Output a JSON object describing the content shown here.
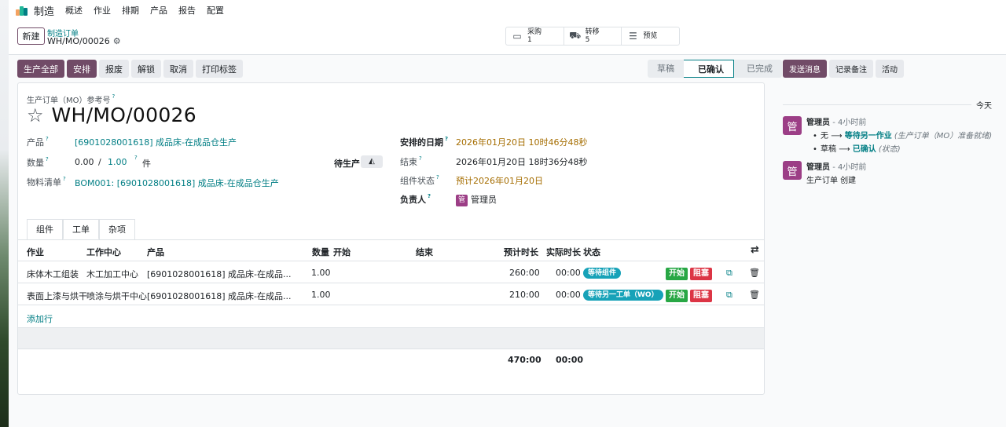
{
  "navbar": {
    "app_name": "制造",
    "menus": [
      "概述",
      "作业",
      "排期",
      "产品",
      "报告",
      "配置"
    ]
  },
  "control_panel": {
    "new_label": "新建",
    "breadcrumb_parent": "制造订单",
    "breadcrumb_current": "WH/MO/00026",
    "smart_buttons": [
      {
        "icon": "credit-card-icon",
        "label": "采购",
        "count": "1"
      },
      {
        "icon": "truck-icon",
        "label": "转移",
        "count": "5"
      },
      {
        "icon": "list-icon",
        "label": "预览",
        "count": ""
      }
    ]
  },
  "actions": [
    "生产全部",
    "安排",
    "报废",
    "解锁",
    "取消",
    "打印标签"
  ],
  "statusbar": [
    "草稿",
    "已确认",
    "已完成"
  ],
  "chatter": {
    "buttons": [
      "发送消息",
      "记录备注",
      "活动"
    ],
    "day": "今天",
    "messages": [
      {
        "avatar": "管",
        "author": "管理员",
        "time": "- 4小时前",
        "tracking": [
          {
            "old": "无",
            "new": "等待另一作业",
            "field": "(生产订单（MO）准备就绪)"
          },
          {
            "old": "草稿",
            "new": "已确认",
            "field": "(状态)"
          }
        ]
      },
      {
        "avatar": "管",
        "author": "管理员",
        "time": "- 4小时前",
        "body": "生产订单 创建"
      }
    ]
  },
  "form": {
    "ref_label": "生产订单（MO）参考号",
    "title": "WH/MO/00026",
    "product_label": "产品",
    "product_value": "[6901028001618] 成品床-在成品仓生产",
    "qty_label": "数量",
    "qty_produced": "0.00",
    "qty_sep": "/",
    "qty_total": "1.00",
    "uom": "件",
    "to_produce_label": "待生产",
    "bom_label": "物料清单",
    "bom_value": "BOM001: [6901028001618] 成品床-在成品仓生产",
    "scheduled_label": "安排的日期",
    "scheduled_value": "2026年01月20日 10时46分48秒",
    "end_label": "结束",
    "end_value": "2026年01月20日 18时36分48秒",
    "component_status_label": "组件状态",
    "component_status_value": "预计2026年01月20日",
    "responsible_label": "负责人",
    "responsible_avatar": "管",
    "responsible_value": "管理员"
  },
  "tabs": [
    "组件",
    "工单",
    "杂项"
  ],
  "workorders": {
    "headers": [
      "作业",
      "工作中心",
      "产品",
      "数量",
      "开始",
      "结束",
      "预计时长",
      "实际时长",
      "状态"
    ],
    "rows": [
      {
        "operation": "床体木工组装",
        "workcenter": "木工加工中心",
        "product": "[6901028001618] 成品床-在成品...",
        "qty": "1.00",
        "expected": "260:00",
        "actual": "00:00",
        "status": "等待组件"
      },
      {
        "operation": "表面上漆与烘干",
        "workcenter": "喷涂与烘干中心",
        "product": "[6901028001618] 成品床-在成品...",
        "qty": "1.00",
        "expected": "210:00",
        "actual": "00:00",
        "status": "等待另一工单（WO）"
      }
    ],
    "start_label": "开始",
    "block_label": "阻塞",
    "add_line": "添加行",
    "total_expected": "470:00",
    "total_actual": "00:00"
  },
  "colors": {
    "brand": "#714b67",
    "link": "#017e84",
    "badge": "#17a2b8",
    "start": "#28a745",
    "block": "#dc3545"
  }
}
